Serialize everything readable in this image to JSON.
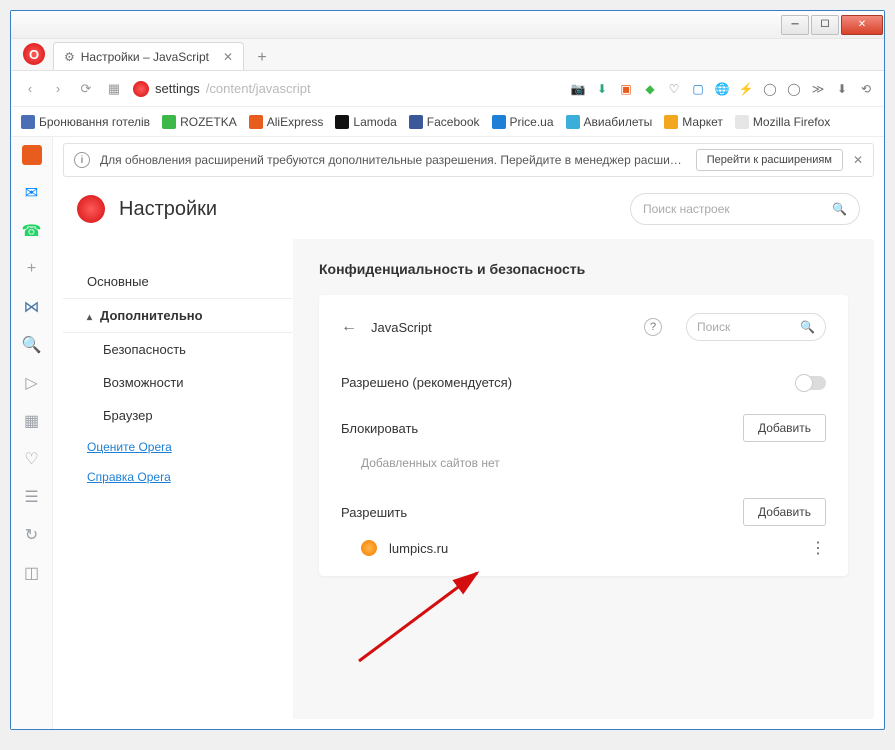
{
  "tab": {
    "title": "Настройки – JavaScript"
  },
  "url": {
    "prefix": "settings",
    "path": "/content/javascript"
  },
  "bookmarks": [
    {
      "label": "Бронювання готелів",
      "color": "#4a6fb5"
    },
    {
      "label": "ROZETKA",
      "color": "#3db94a"
    },
    {
      "label": "AliExpress",
      "color": "#e85c1e"
    },
    {
      "label": "Lamoda",
      "color": "#111"
    },
    {
      "label": "Facebook",
      "color": "#3b5998"
    },
    {
      "label": "Price.ua",
      "color": "#1e7fd6"
    },
    {
      "label": "Авиабилеты",
      "color": "#3bafda"
    },
    {
      "label": "Маркет",
      "color": "#f3a71e"
    },
    {
      "label": "Mozilla Firefox",
      "color": "#e6e6e6"
    }
  ],
  "notice": {
    "text": "Для обновления расширений требуются дополнительные разрешения. Перейдите в менеджер расширений для подт...",
    "button": "Перейти к расширениям"
  },
  "pageTitle": "Настройки",
  "searchSettings": {
    "placeholder": "Поиск настроек"
  },
  "sidebar": {
    "main": "Основные",
    "advanced": "Дополнительно",
    "security": "Безопасность",
    "features": "Возможности",
    "browser": "Браузер",
    "rate": "Оцените Opera",
    "help": "Справка Opera"
  },
  "panel": {
    "heading": "Конфиденциальность и безопасность",
    "cardTitle": "JavaScript",
    "search": {
      "placeholder": "Поиск"
    },
    "allowed": "Разрешено (рекомендуется)",
    "block": {
      "title": "Блокировать",
      "add": "Добавить",
      "empty": "Добавленных сайтов нет"
    },
    "allow": {
      "title": "Разрешить",
      "add": "Добавить",
      "site": "lumpics.ru"
    }
  }
}
